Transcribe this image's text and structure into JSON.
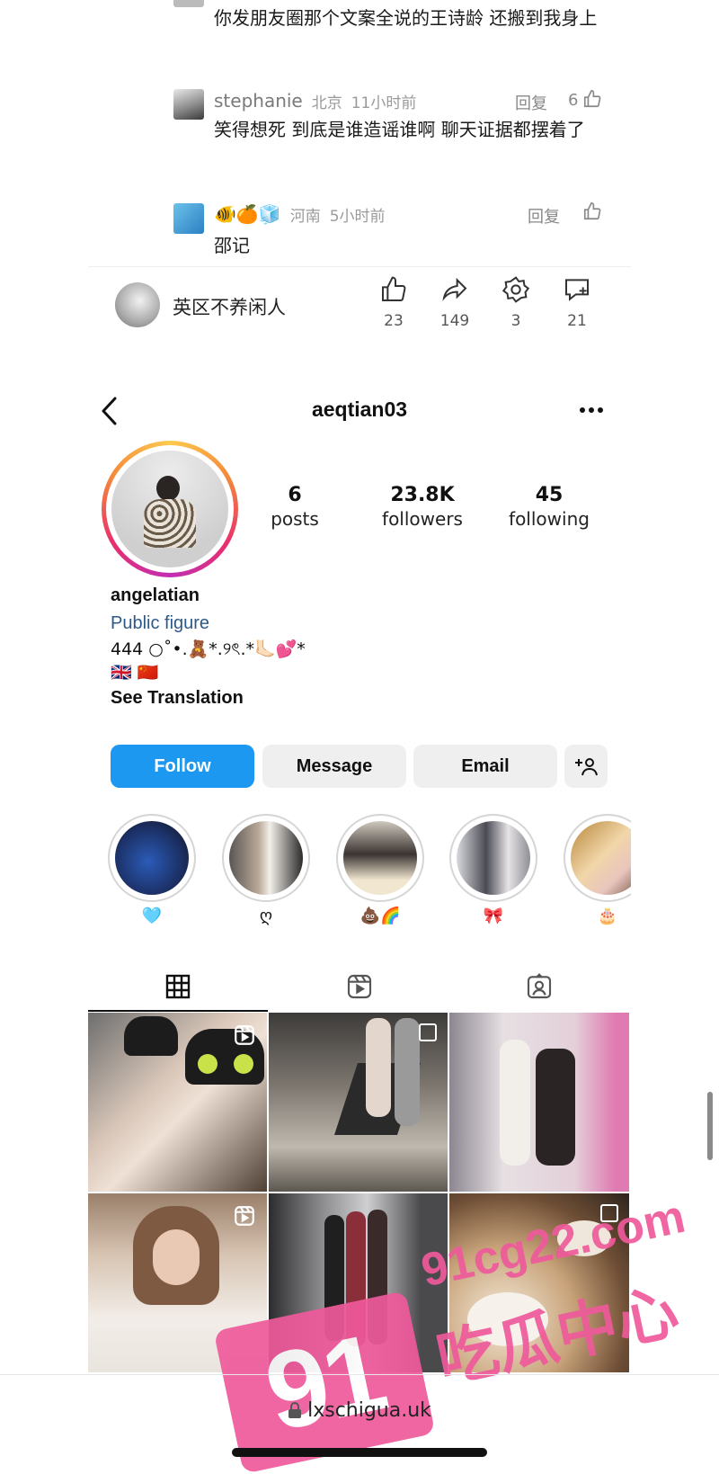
{
  "comments": [
    {
      "text": "你发朋友圈那个文案全说的王诗龄 还搬到我身上"
    },
    {
      "name": "stephanie",
      "location": "北京",
      "time": "11小时前",
      "reply": "回复",
      "likes": "6",
      "text": "笑得想死 到底是谁造谣谁啊 聊天证据都摆着了"
    },
    {
      "name": "🐠🍊🧊",
      "location": "河南",
      "time": "5小时前",
      "reply": "回复",
      "likes": "",
      "text": "邵记"
    }
  ],
  "post_bar": {
    "author": "英区不养闲人",
    "actions": [
      {
        "icon": "thumbs-up-icon",
        "count": "23"
      },
      {
        "icon": "share-icon",
        "count": "149"
      },
      {
        "icon": "star-badge-icon",
        "count": "3"
      },
      {
        "icon": "comment-add-icon",
        "count": "21"
      }
    ]
  },
  "profile": {
    "handle": "aeqtian03",
    "stats": [
      {
        "number": "6",
        "label": "posts"
      },
      {
        "number": "23.8K",
        "label": "followers"
      },
      {
        "number": "45",
        "label": "following"
      }
    ],
    "name": "angelatian",
    "category": "Public figure",
    "bio": "444 ○˚•.🧸*.୨ৎ.*🦶🏻💕*",
    "flags": "🇬🇧 🇨🇳",
    "see_translation": "See Translation",
    "buttons": {
      "follow": "Follow",
      "message": "Message",
      "email": "Email"
    },
    "highlights": [
      {
        "label": "🩵"
      },
      {
        "label": "ღ"
      },
      {
        "label": "💩🌈"
      },
      {
        "label": "🎀"
      },
      {
        "label": "🎂"
      }
    ]
  },
  "watermark": {
    "brand": "91",
    "site": "91cg22.com",
    "tagline": "吃瓜中心"
  },
  "url_bar": {
    "url": "lxschigua.uk"
  },
  "colors": {
    "follow_blue": "#1c98f0",
    "watermark_pink": "#ef5a9b",
    "link_blue": "#2b5a8a"
  }
}
